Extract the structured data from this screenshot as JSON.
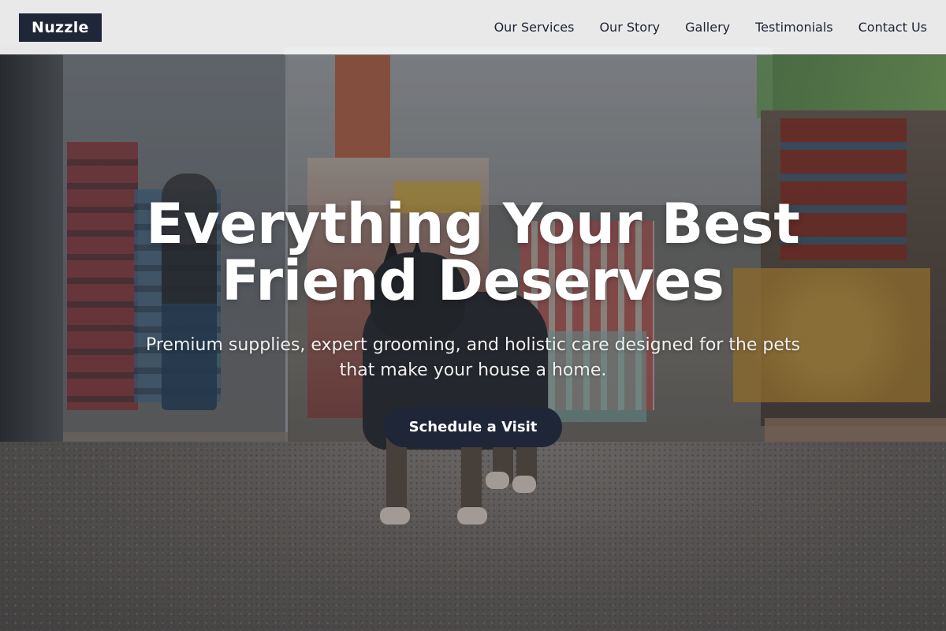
{
  "brand": {
    "name": "Nuzzle"
  },
  "nav": {
    "links": [
      {
        "label": "Our Services"
      },
      {
        "label": "Our Story"
      },
      {
        "label": "Gallery"
      },
      {
        "label": "Testimonials"
      },
      {
        "label": "Contact Us"
      }
    ]
  },
  "hero": {
    "title": "Everything Your Best Friend Deserves",
    "subtitle": "Premium supplies, expert grooming, and holistic care designed for the pets that make your house a home.",
    "cta_label": "Schedule a Visit"
  },
  "colors": {
    "primary": "#1e2638",
    "nav_background": "#f5f5f5",
    "hero_text": "#ffffff"
  }
}
